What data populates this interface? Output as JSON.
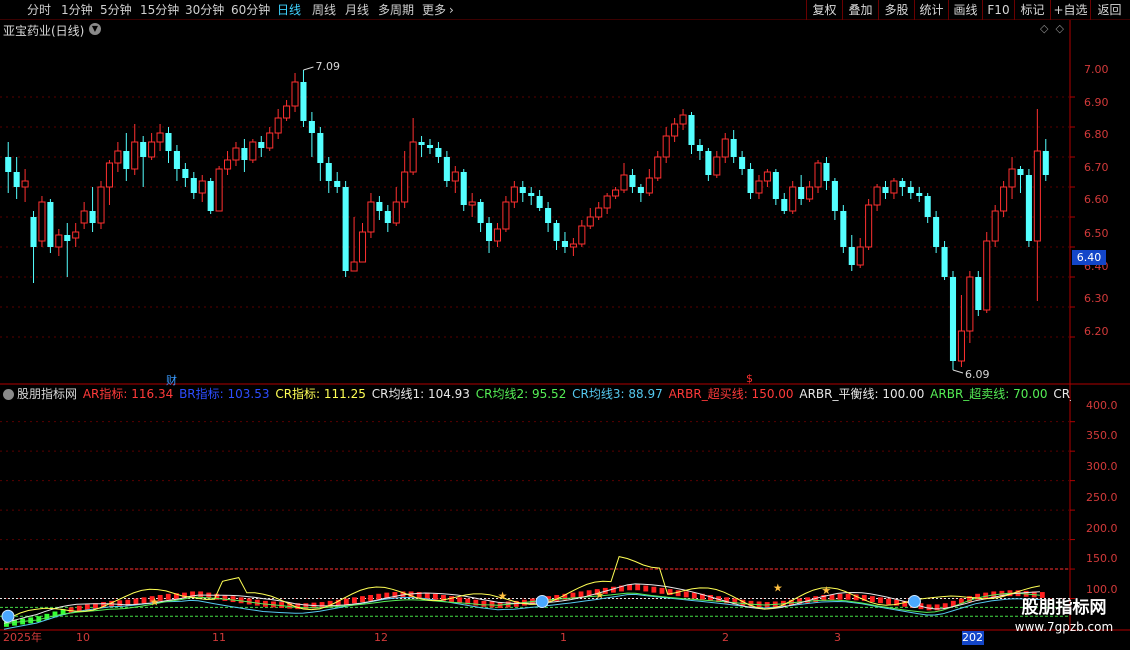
{
  "toolbar": {
    "timeframes": [
      "分时",
      "1分钟",
      "5分钟",
      "15分钟",
      "30分钟",
      "60分钟",
      "日线",
      "周线",
      "月线",
      "多周期",
      "更多"
    ],
    "active_timeframe": "日线",
    "buttons": [
      "复权",
      "叠加",
      "多股",
      "统计",
      "画线",
      "F10",
      "标记",
      "+自选",
      "返回"
    ]
  },
  "stock": {
    "title": "亚宝药业(日线)"
  },
  "price_axis": [
    "7.00",
    "6.90",
    "6.80",
    "6.70",
    "6.60",
    "6.50",
    "6.40",
    "6.30",
    "6.20"
  ],
  "last_price": "6.40",
  "annotations": {
    "high": "7.09",
    "low": "6.09",
    "event_cai": "财",
    "event_s": "$"
  },
  "indicator": {
    "source": "股朋指标网",
    "items": [
      {
        "text": "AR指标: 116.34",
        "color": "#ff3a3a"
      },
      {
        "text": "BR指标: 103.53",
        "color": "#2d4dff"
      },
      {
        "text": "CR指标: 111.25",
        "color": "#ffff55"
      },
      {
        "text": "CR均线1: 104.93",
        "color": "#e8e8e8"
      },
      {
        "text": "CR均线2: 95.52",
        "color": "#55ee55"
      },
      {
        "text": "CR均线3: 88.97",
        "color": "#55c8ee"
      },
      {
        "text": "ARBR_超买线: 150.00",
        "color": "#ff3a3a"
      },
      {
        "text": "ARBR_平衡线: 100.00",
        "color": "#e8e8e8"
      },
      {
        "text": "ARBR_超卖线: 70.00",
        "color": "#55ee55"
      },
      {
        "text": "CR_压力带A:",
        "color": "#e8e8e8"
      }
    ]
  },
  "indicator_axis": [
    "400.0",
    "350.0",
    "300.0",
    "250.0",
    "200.0",
    "150.0",
    "100.0"
  ],
  "date_axis": [
    "2025年",
    "10",
    "11",
    "12",
    "1",
    "2",
    "3",
    "202"
  ],
  "watermark": {
    "name": "股朋指标网",
    "url": "www.7gpzb.com"
  },
  "chart_data": {
    "type": "candlestick",
    "ylim": [
      6.1,
      7.1
    ],
    "candles": [
      [
        6.8,
        6.75,
        6.85,
        6.68
      ],
      [
        6.75,
        6.7,
        6.8,
        6.66
      ],
      [
        6.7,
        6.72,
        6.76,
        6.65
      ],
      [
        6.6,
        6.5,
        6.62,
        6.38
      ],
      [
        6.52,
        6.65,
        6.67,
        6.5
      ],
      [
        6.65,
        6.5,
        6.66,
        6.48
      ],
      [
        6.5,
        6.54,
        6.56,
        6.47
      ],
      [
        6.54,
        6.52,
        6.58,
        6.4
      ],
      [
        6.53,
        6.55,
        6.58,
        6.5
      ],
      [
        6.58,
        6.62,
        6.65,
        6.56
      ],
      [
        6.62,
        6.58,
        6.7,
        6.55
      ],
      [
        6.58,
        6.7,
        6.72,
        6.56
      ],
      [
        6.7,
        6.78,
        6.79,
        6.64
      ],
      [
        6.78,
        6.82,
        6.85,
        6.75
      ],
      [
        6.82,
        6.76,
        6.88,
        6.72
      ],
      [
        6.76,
        6.85,
        6.91,
        6.74
      ],
      [
        6.85,
        6.8,
        6.87,
        6.7
      ],
      [
        6.8,
        6.85,
        6.88,
        6.79
      ],
      [
        6.85,
        6.88,
        6.91,
        6.82
      ],
      [
        6.88,
        6.82,
        6.9,
        6.78
      ],
      [
        6.82,
        6.76,
        6.84,
        6.72
      ],
      [
        6.76,
        6.73,
        6.78,
        6.7
      ],
      [
        6.73,
        6.68,
        6.75,
        6.66
      ],
      [
        6.68,
        6.72,
        6.74,
        6.65
      ],
      [
        6.72,
        6.62,
        6.73,
        6.61
      ],
      [
        6.62,
        6.76,
        6.77,
        6.62
      ],
      [
        6.76,
        6.79,
        6.82,
        6.74
      ],
      [
        6.79,
        6.83,
        6.85,
        6.77
      ],
      [
        6.83,
        6.79,
        6.86,
        6.75
      ],
      [
        6.79,
        6.85,
        6.86,
        6.78
      ],
      [
        6.85,
        6.83,
        6.87,
        6.8
      ],
      [
        6.83,
        6.88,
        6.9,
        6.82
      ],
      [
        6.88,
        6.93,
        6.96,
        6.86
      ],
      [
        6.93,
        6.97,
        6.99,
        6.92
      ],
      [
        6.97,
        7.05,
        7.08,
        6.95
      ],
      [
        7.05,
        6.92,
        7.09,
        6.9
      ],
      [
        6.92,
        6.88,
        6.95,
        6.8
      ],
      [
        6.88,
        6.78,
        6.9,
        6.72
      ],
      [
        6.78,
        6.72,
        6.8,
        6.68
      ],
      [
        6.72,
        6.7,
        6.75,
        6.68
      ],
      [
        6.7,
        6.42,
        6.72,
        6.4
      ],
      [
        6.42,
        6.45,
        6.6,
        6.43
      ],
      [
        6.45,
        6.55,
        6.58,
        6.48
      ],
      [
        6.55,
        6.65,
        6.68,
        6.53
      ],
      [
        6.65,
        6.62,
        6.67,
        6.59
      ],
      [
        6.62,
        6.58,
        6.64,
        6.55
      ],
      [
        6.58,
        6.65,
        6.7,
        6.57
      ],
      [
        6.65,
        6.75,
        6.82,
        6.63
      ],
      [
        6.75,
        6.85,
        6.93,
        6.74
      ],
      [
        6.85,
        6.84,
        6.87,
        6.8
      ],
      [
        6.84,
        6.83,
        6.86,
        6.81
      ],
      [
        6.83,
        6.8,
        6.85,
        6.78
      ],
      [
        6.8,
        6.72,
        6.82,
        6.7
      ],
      [
        6.72,
        6.75,
        6.77,
        6.68
      ],
      [
        6.75,
        6.64,
        6.76,
        6.62
      ],
      [
        6.64,
        6.65,
        6.68,
        6.6
      ],
      [
        6.65,
        6.58,
        6.66,
        6.55
      ],
      [
        6.58,
        6.52,
        6.6,
        6.48
      ],
      [
        6.52,
        6.56,
        6.58,
        6.5
      ],
      [
        6.56,
        6.65,
        6.67,
        6.55
      ],
      [
        6.65,
        6.7,
        6.72,
        6.63
      ],
      [
        6.7,
        6.68,
        6.72,
        6.65
      ],
      [
        6.68,
        6.67,
        6.7,
        6.64
      ],
      [
        6.67,
        6.63,
        6.69,
        6.62
      ],
      [
        6.63,
        6.58,
        6.65,
        6.55
      ],
      [
        6.58,
        6.52,
        6.59,
        6.49
      ],
      [
        6.52,
        6.5,
        6.55,
        6.48
      ],
      [
        6.5,
        6.51,
        6.53,
        6.47
      ],
      [
        6.51,
        6.57,
        6.59,
        6.5
      ],
      [
        6.57,
        6.6,
        6.63,
        6.56
      ],
      [
        6.6,
        6.63,
        6.65,
        6.59
      ],
      [
        6.63,
        6.67,
        6.68,
        6.61
      ],
      [
        6.67,
        6.69,
        6.7,
        6.66
      ],
      [
        6.69,
        6.74,
        6.78,
        6.68
      ],
      [
        6.74,
        6.7,
        6.76,
        6.68
      ],
      [
        6.7,
        6.68,
        6.71,
        6.65
      ],
      [
        6.68,
        6.73,
        6.76,
        6.67
      ],
      [
        6.73,
        6.8,
        6.82,
        6.72
      ],
      [
        6.8,
        6.87,
        6.9,
        6.78
      ],
      [
        6.87,
        6.91,
        6.93,
        6.85
      ],
      [
        6.91,
        6.94,
        6.96,
        6.89
      ],
      [
        6.94,
        6.84,
        6.95,
        6.81
      ],
      [
        6.84,
        6.82,
        6.86,
        6.79
      ],
      [
        6.82,
        6.74,
        6.83,
        6.72
      ],
      [
        6.74,
        6.8,
        6.82,
        6.73
      ],
      [
        6.8,
        6.86,
        6.88,
        6.78
      ],
      [
        6.86,
        6.8,
        6.89,
        6.78
      ],
      [
        6.8,
        6.76,
        6.82,
        6.74
      ],
      [
        6.76,
        6.68,
        6.78,
        6.66
      ],
      [
        6.68,
        6.72,
        6.74,
        6.66
      ],
      [
        6.72,
        6.75,
        6.76,
        6.7
      ],
      [
        6.75,
        6.66,
        6.76,
        6.64
      ],
      [
        6.66,
        6.62,
        6.68,
        6.61
      ],
      [
        6.62,
        6.7,
        6.72,
        6.61
      ],
      [
        6.7,
        6.66,
        6.74,
        6.64
      ],
      [
        6.66,
        6.7,
        6.72,
        6.65
      ],
      [
        6.7,
        6.78,
        6.79,
        6.68
      ],
      [
        6.78,
        6.72,
        6.8,
        6.69
      ],
      [
        6.72,
        6.62,
        6.73,
        6.59
      ],
      [
        6.62,
        6.5,
        6.64,
        6.48
      ],
      [
        6.5,
        6.44,
        6.54,
        6.42
      ],
      [
        6.44,
        6.5,
        6.53,
        6.43
      ],
      [
        6.5,
        6.64,
        6.66,
        6.49
      ],
      [
        6.64,
        6.7,
        6.71,
        6.62
      ],
      [
        6.7,
        6.68,
        6.72,
        6.66
      ],
      [
        6.68,
        6.72,
        6.73,
        6.66
      ],
      [
        6.72,
        6.7,
        6.73,
        6.67
      ],
      [
        6.7,
        6.68,
        6.72,
        6.66
      ],
      [
        6.68,
        6.67,
        6.7,
        6.65
      ],
      [
        6.67,
        6.6,
        6.68,
        6.58
      ],
      [
        6.6,
        6.5,
        6.62,
        6.48
      ],
      [
        6.5,
        6.4,
        6.52,
        6.39
      ],
      [
        6.4,
        6.12,
        6.42,
        6.09
      ],
      [
        6.12,
        6.22,
        6.34,
        6.1
      ],
      [
        6.22,
        6.4,
        6.42,
        6.18
      ],
      [
        6.4,
        6.29,
        6.42,
        6.27
      ],
      [
        6.29,
        6.52,
        6.55,
        6.28
      ],
      [
        6.52,
        6.62,
        6.64,
        6.5
      ],
      [
        6.62,
        6.7,
        6.72,
        6.6
      ],
      [
        6.7,
        6.76,
        6.8,
        6.66
      ],
      [
        6.76,
        6.74,
        6.77,
        6.68
      ],
      [
        6.74,
        6.52,
        6.76,
        6.5
      ],
      [
        6.52,
        6.82,
        6.96,
        6.32
      ],
      [
        6.82,
        6.74,
        6.86,
        6.72
      ]
    ],
    "indicator": {
      "ylim": [
        50,
        430
      ],
      "levels": {
        "ARBR_超买线": 150,
        "ARBR_平衡线": 100,
        "ARBR_超卖线": 70
      },
      "red_band": [
        62,
        64,
        66,
        68,
        70,
        74,
        78,
        82,
        85,
        88,
        90,
        92,
        94,
        96,
        97,
        98,
        100,
        102,
        104,
        106,
        108,
        109,
        110,
        112,
        112,
        110,
        108,
        106,
        104,
        102,
        100,
        98,
        96,
        95,
        94,
        93,
        92,
        92,
        93,
        94,
        96,
        98,
        100,
        102,
        104,
        106,
        108,
        110,
        111,
        112,
        112,
        111,
        110,
        108,
        106,
        104,
        102,
        100,
        98,
        96,
        95,
        94,
        95,
        96,
        98,
        100,
        102,
        104,
        106,
        108,
        110,
        112,
        114,
        116,
        118,
        120,
        122,
        124,
        124,
        122,
        120,
        118,
        116,
        114,
        112,
        110,
        108,
        106,
        104,
        102,
        100,
        98,
        96,
        95,
        94,
        95,
        96,
        98,
        100,
        102,
        104,
        106,
        107,
        108,
        108,
        107,
        106,
        104,
        102,
        100,
        98,
        96,
        94,
        92,
        90,
        90,
        92,
        96,
        100,
        104,
        108,
        110,
        112,
        113,
        114,
        114,
        113,
        112,
        111
      ]
    }
  }
}
